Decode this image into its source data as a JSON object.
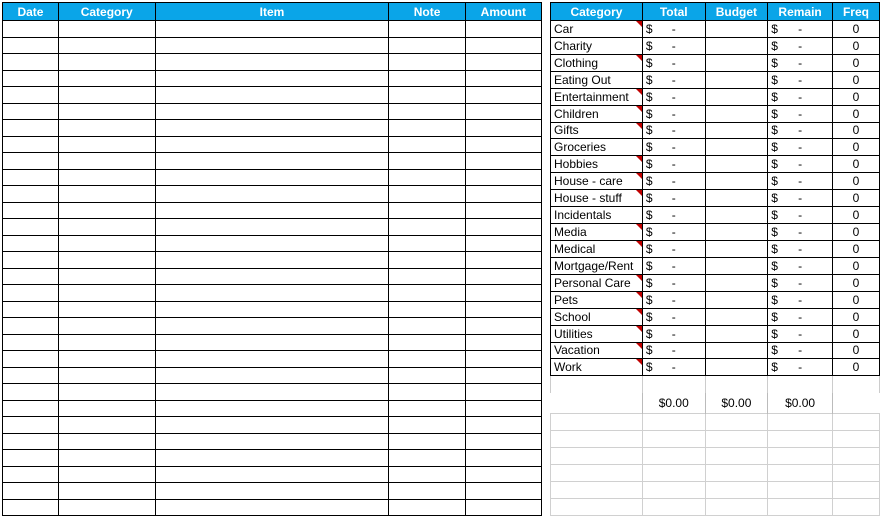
{
  "left_headers": [
    "Date",
    "Category",
    "Item",
    "Note",
    "Amount"
  ],
  "right_headers": [
    "Category",
    "Total",
    "Budget",
    "Remain",
    "Freq"
  ],
  "left_rows": 30,
  "categories": [
    {
      "name": "Car",
      "total_sym": "$",
      "total_val": "-",
      "budget": "",
      "remain_sym": "$",
      "remain_val": "-",
      "freq": "0",
      "marker": true
    },
    {
      "name": "Charity",
      "total_sym": "$",
      "total_val": "-",
      "budget": "",
      "remain_sym": "$",
      "remain_val": "-",
      "freq": "0",
      "marker": false
    },
    {
      "name": "Clothing",
      "total_sym": "$",
      "total_val": "-",
      "budget": "",
      "remain_sym": "$",
      "remain_val": "-",
      "freq": "0",
      "marker": true
    },
    {
      "name": "Eating Out",
      "total_sym": "$",
      "total_val": "-",
      "budget": "",
      "remain_sym": "$",
      "remain_val": "-",
      "freq": "0",
      "marker": false
    },
    {
      "name": "Entertainment",
      "total_sym": "$",
      "total_val": "-",
      "budget": "",
      "remain_sym": "$",
      "remain_val": "-",
      "freq": "0",
      "marker": true
    },
    {
      "name": "Children",
      "total_sym": "$",
      "total_val": "-",
      "budget": "",
      "remain_sym": "$",
      "remain_val": "-",
      "freq": "0",
      "marker": true
    },
    {
      "name": "Gifts",
      "total_sym": "$",
      "total_val": "-",
      "budget": "",
      "remain_sym": "$",
      "remain_val": "-",
      "freq": "0",
      "marker": true
    },
    {
      "name": "Groceries",
      "total_sym": "$",
      "total_val": "-",
      "budget": "",
      "remain_sym": "$",
      "remain_val": "-",
      "freq": "0",
      "marker": false
    },
    {
      "name": "Hobbies",
      "total_sym": "$",
      "total_val": "-",
      "budget": "",
      "remain_sym": "$",
      "remain_val": "-",
      "freq": "0",
      "marker": true
    },
    {
      "name": "House - care",
      "total_sym": "$",
      "total_val": "-",
      "budget": "",
      "remain_sym": "$",
      "remain_val": "-",
      "freq": "0",
      "marker": true
    },
    {
      "name": "House - stuff",
      "total_sym": "$",
      "total_val": "-",
      "budget": "",
      "remain_sym": "$",
      "remain_val": "-",
      "freq": "0",
      "marker": true
    },
    {
      "name": "Incidentals",
      "total_sym": "$",
      "total_val": "-",
      "budget": "",
      "remain_sym": "$",
      "remain_val": "-",
      "freq": "0",
      "marker": false
    },
    {
      "name": "Media",
      "total_sym": "$",
      "total_val": "-",
      "budget": "",
      "remain_sym": "$",
      "remain_val": "-",
      "freq": "0",
      "marker": true
    },
    {
      "name": "Medical",
      "total_sym": "$",
      "total_val": "-",
      "budget": "",
      "remain_sym": "$",
      "remain_val": "-",
      "freq": "0",
      "marker": true
    },
    {
      "name": "Mortgage/Rent",
      "total_sym": "$",
      "total_val": "-",
      "budget": "",
      "remain_sym": "$",
      "remain_val": "-",
      "freq": "0",
      "marker": false
    },
    {
      "name": "Personal Care",
      "total_sym": "$",
      "total_val": "-",
      "budget": "",
      "remain_sym": "$",
      "remain_val": "-",
      "freq": "0",
      "marker": true
    },
    {
      "name": "Pets",
      "total_sym": "$",
      "total_val": "-",
      "budget": "",
      "remain_sym": "$",
      "remain_val": "-",
      "freq": "0",
      "marker": true
    },
    {
      "name": "School",
      "total_sym": "$",
      "total_val": "-",
      "budget": "",
      "remain_sym": "$",
      "remain_val": "-",
      "freq": "0",
      "marker": true
    },
    {
      "name": "Utilities",
      "total_sym": "$",
      "total_val": "-",
      "budget": "",
      "remain_sym": "$",
      "remain_val": "-",
      "freq": "0",
      "marker": true
    },
    {
      "name": "Vacation",
      "total_sym": "$",
      "total_val": "-",
      "budget": "",
      "remain_sym": "$",
      "remain_val": "-",
      "freq": "0",
      "marker": true
    },
    {
      "name": "Work",
      "total_sym": "$",
      "total_val": "-",
      "budget": "",
      "remain_sym": "$",
      "remain_val": "-",
      "freq": "0",
      "marker": true
    }
  ],
  "totals": {
    "total": "$0.00",
    "budget": "$0.00",
    "remain": "$0.00"
  }
}
